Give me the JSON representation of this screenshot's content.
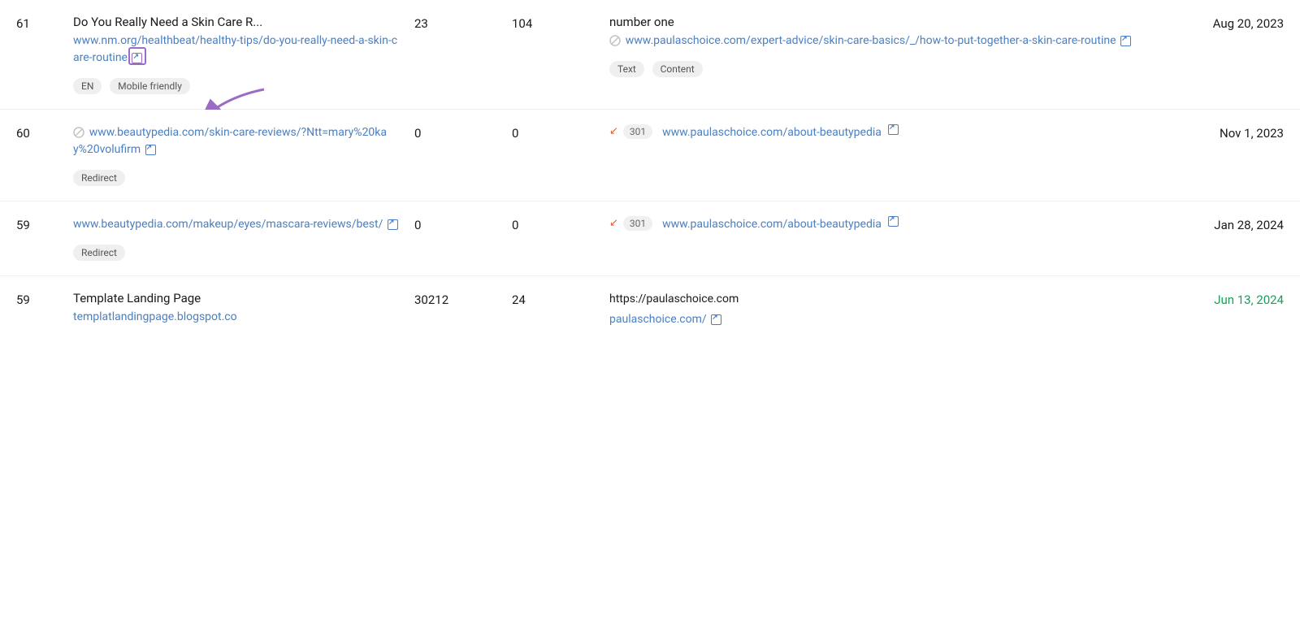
{
  "rows": [
    {
      "rank": "61",
      "page_title": "Do You Really Need a Skin Care R...",
      "page_url": "www.nm.org/healthbeat/healthy-tips/do-you-really-need-a-skin-care-routine",
      "page_url_icon": true,
      "badges": [
        "EN",
        "Mobile friendly"
      ],
      "num1": "23",
      "num2": "104",
      "ref_label": "number one",
      "ref_url": "www.paulaschoice.com/expert-advice/skin-care-basics/_/how-to-put-together-a-skin-care-routine",
      "ref_url_icon": true,
      "ref_badges": [
        "Text",
        "Content"
      ],
      "ref_redirect": null,
      "date": "Aug 20, 2023",
      "date_green": false
    },
    {
      "rank": "60",
      "page_title": null,
      "page_url": "www.beautypedia.com/skin-care-reviews/?Ntt=mary%20kay%20volufirm",
      "page_url_icon": true,
      "page_redirect_icon": true,
      "badges": [
        "Redirect"
      ],
      "num1": "0",
      "num2": "0",
      "ref_label": null,
      "ref_url": "www.paulaschoice.com/about-beautypedia",
      "ref_url_icon": true,
      "ref_redirect": "301",
      "ref_badges": [],
      "date": "Nov 1, 2023",
      "date_green": false
    },
    {
      "rank": "59",
      "page_title": null,
      "page_url": "www.beautypedia.com/makeup/eyes/mascara-reviews/best/",
      "page_url_icon": true,
      "page_redirect_icon": false,
      "badges": [
        "Redirect"
      ],
      "num1": "0",
      "num2": "0",
      "ref_label": null,
      "ref_url": "www.paulaschoice.com/about-beautypedia",
      "ref_url_icon": true,
      "ref_redirect": "301",
      "ref_badges": [],
      "date": "Jan 28, 2024",
      "date_green": false
    },
    {
      "rank": "59",
      "page_title": "Template Landing Page",
      "page_url": "templatlandingpage.blogspot.co",
      "page_url_icon": false,
      "badges": [],
      "num1": "30212",
      "num2": "24",
      "ref_label": null,
      "ref_url": "https://paulaschoice.com",
      "ref_url2": "paulaschoice.com/",
      "ref_url2_icon": true,
      "ref_redirect": null,
      "ref_badges": [],
      "date": "Jun 13, 2024",
      "date_green": true
    }
  ],
  "annotation": {
    "label": "external link icon highlighted"
  }
}
